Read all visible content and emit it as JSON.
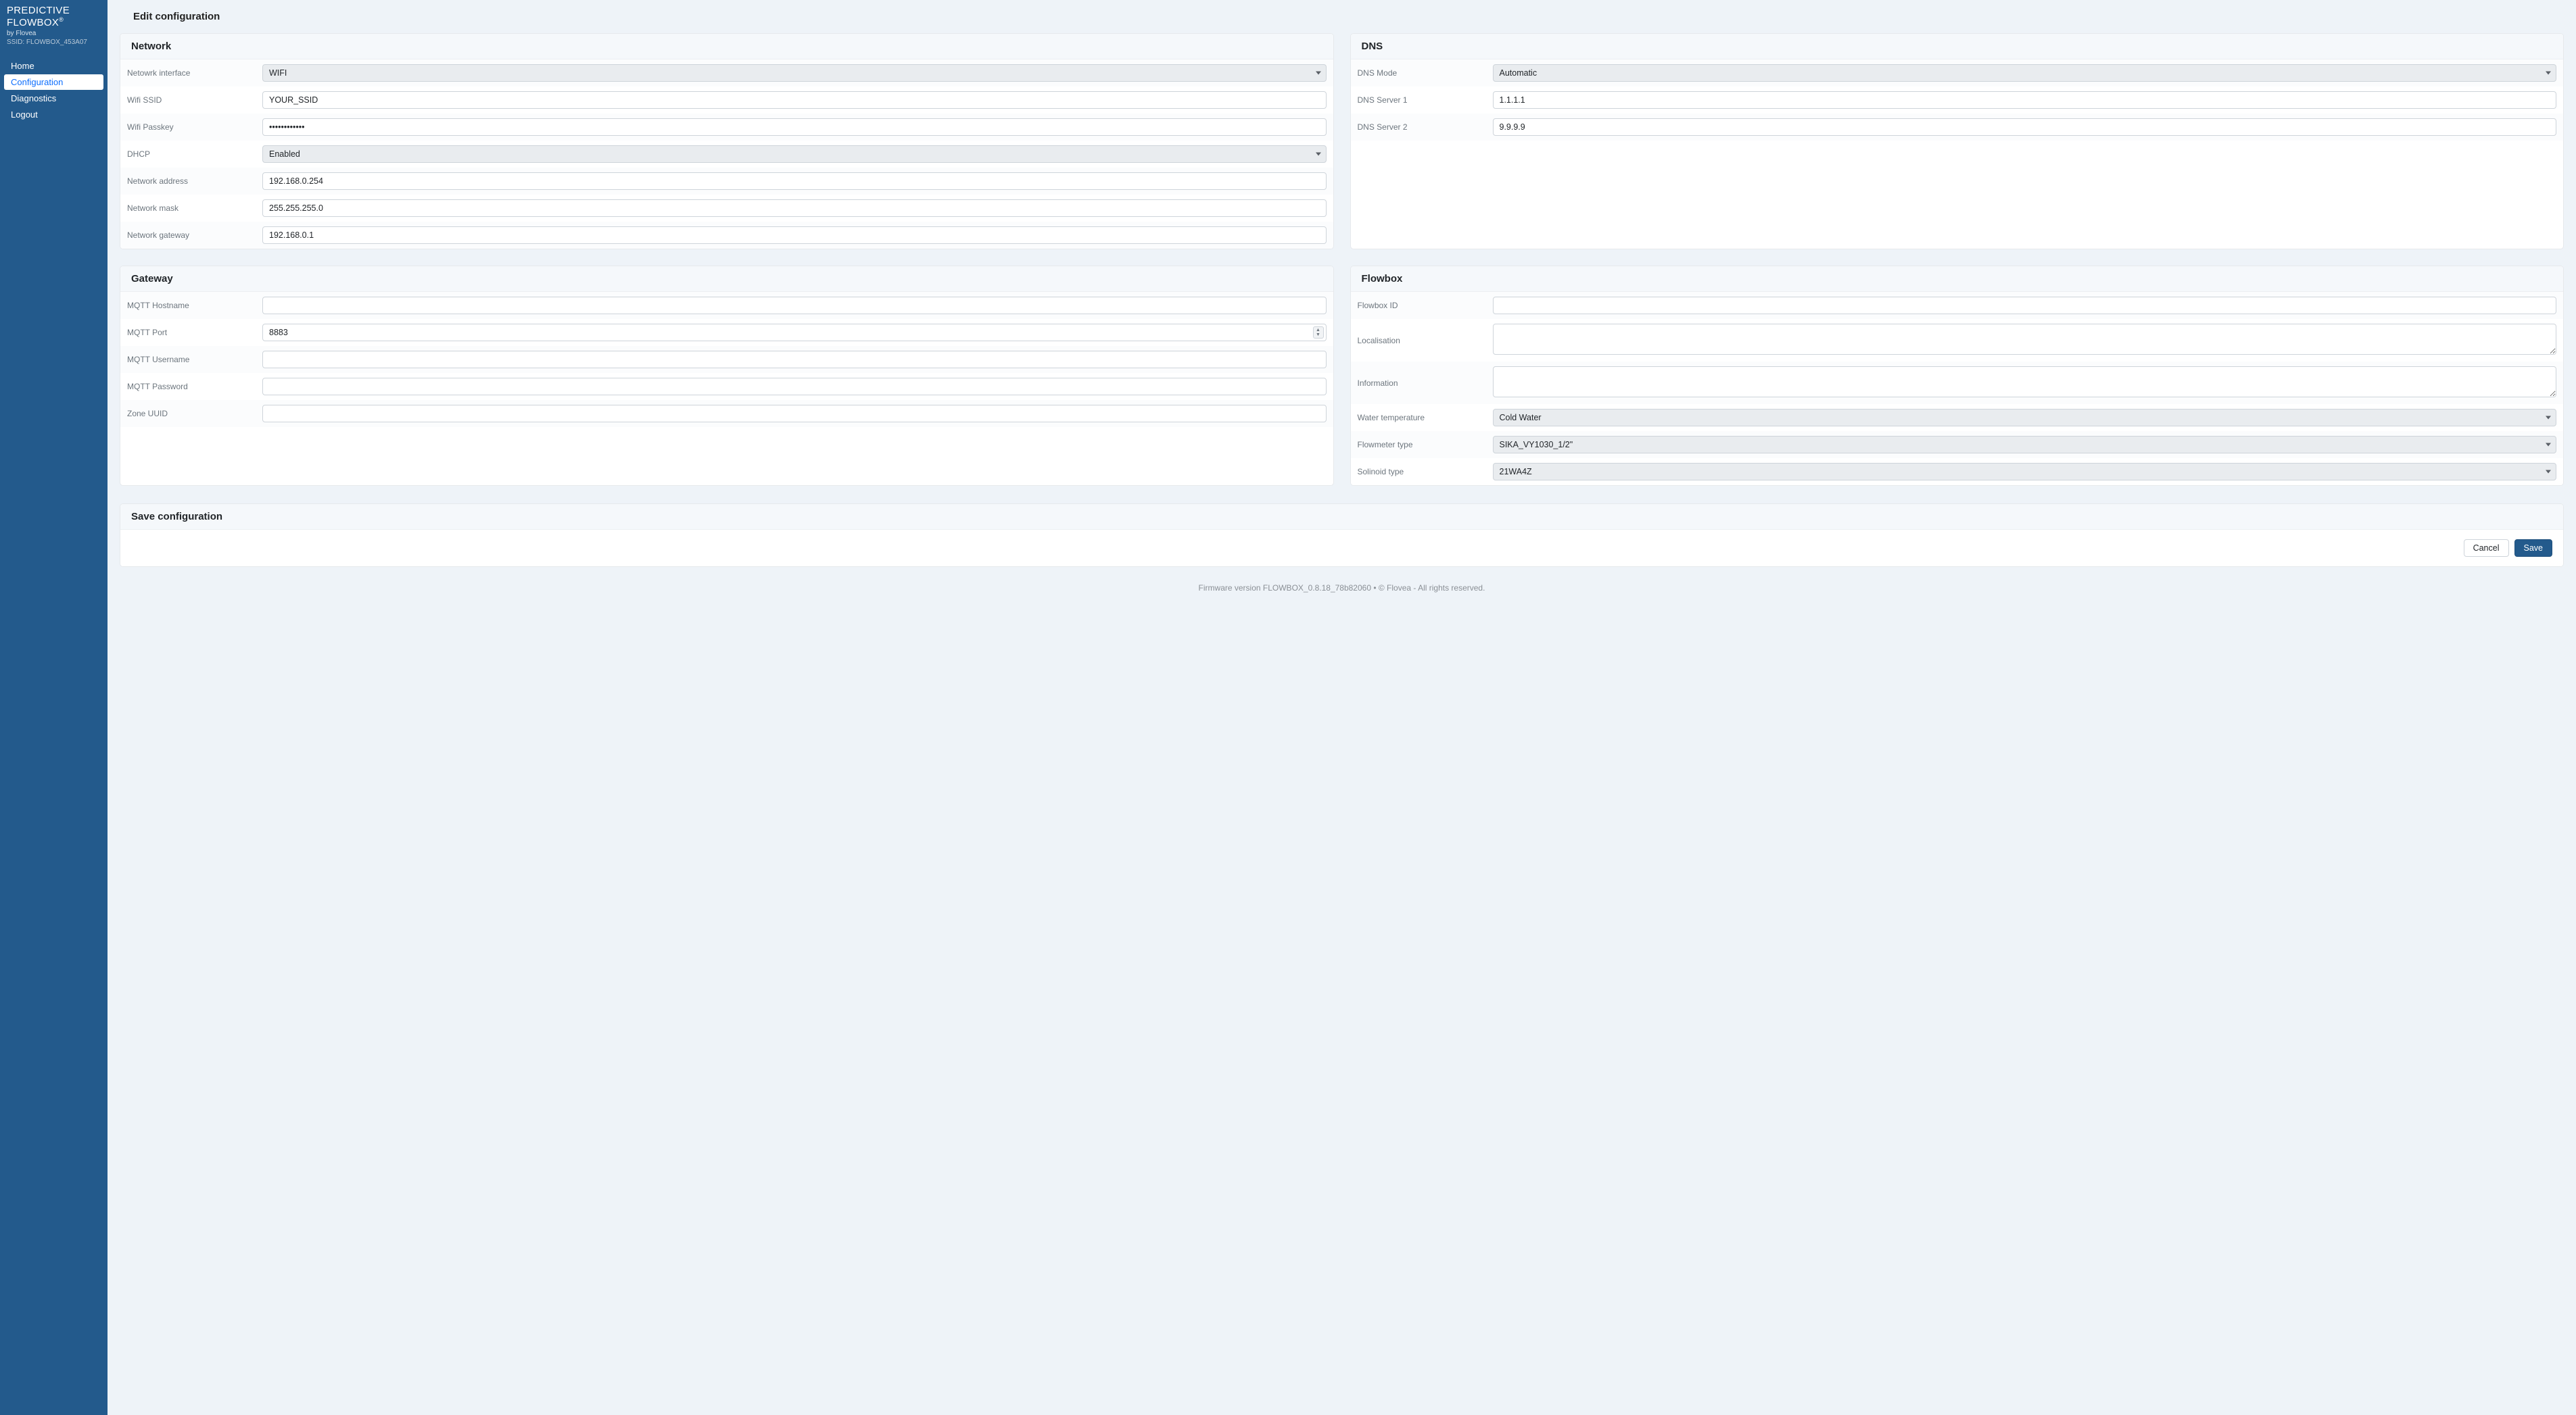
{
  "brand": {
    "title_line1": "PREDICTIVE",
    "title_line2": "FLOWBOX",
    "reg": "®",
    "byline": "by Flovea",
    "ssid_label": "SSID: FLOWBOX_453A07"
  },
  "nav": {
    "home": "Home",
    "configuration": "Configuration",
    "diagnostics": "Diagnostics",
    "logout": "Logout",
    "active": "configuration"
  },
  "page": {
    "title": "Edit configuration"
  },
  "network": {
    "card_title": "Network",
    "fields": {
      "interface_label": "Netowrk interface",
      "interface_value": "WIFI",
      "ssid_label": "Wifi SSID",
      "ssid_value": "YOUR_SSID",
      "passkey_label": "Wifi Passkey",
      "passkey_value": "••••••••••••",
      "dhcp_label": "DHCP",
      "dhcp_value": "Enabled",
      "address_label": "Network address",
      "address_value": "192.168.0.254",
      "mask_label": "Network mask",
      "mask_value": "255.255.255.0",
      "gateway_label": "Network gateway",
      "gateway_value": "192.168.0.1"
    }
  },
  "dns": {
    "card_title": "DNS",
    "fields": {
      "mode_label": "DNS Mode",
      "mode_value": "Automatic",
      "server1_label": "DNS Server 1",
      "server1_value": "1.1.1.1",
      "server2_label": "DNS Server 2",
      "server2_value": "9.9.9.9"
    }
  },
  "gateway": {
    "card_title": "Gateway",
    "fields": {
      "host_label": "MQTT Hostname",
      "host_value": "",
      "port_label": "MQTT Port",
      "port_value": "8883",
      "user_label": "MQTT Username",
      "user_value": "",
      "pass_label": "MQTT Password",
      "pass_value": "",
      "zone_label": "Zone UUID",
      "zone_value": ""
    }
  },
  "flowbox": {
    "card_title": "Flowbox",
    "fields": {
      "id_label": "Flowbox ID",
      "id_value": "",
      "loc_label": "Localisation",
      "loc_value": "",
      "info_label": "Information",
      "info_value": "",
      "water_label": "Water temperature",
      "water_value": "Cold Water",
      "meter_label": "Flowmeter type",
      "meter_value": "SIKA_VY1030_1/2\"",
      "sol_label": "Solinoid type",
      "sol_value": "21WA4Z"
    }
  },
  "save": {
    "card_title": "Save configuration",
    "cancel": "Cancel",
    "save": "Save"
  },
  "footer": {
    "text": "Firmware version FLOWBOX_0.8.18_78b82060 • © Flovea - All rights reserved."
  }
}
